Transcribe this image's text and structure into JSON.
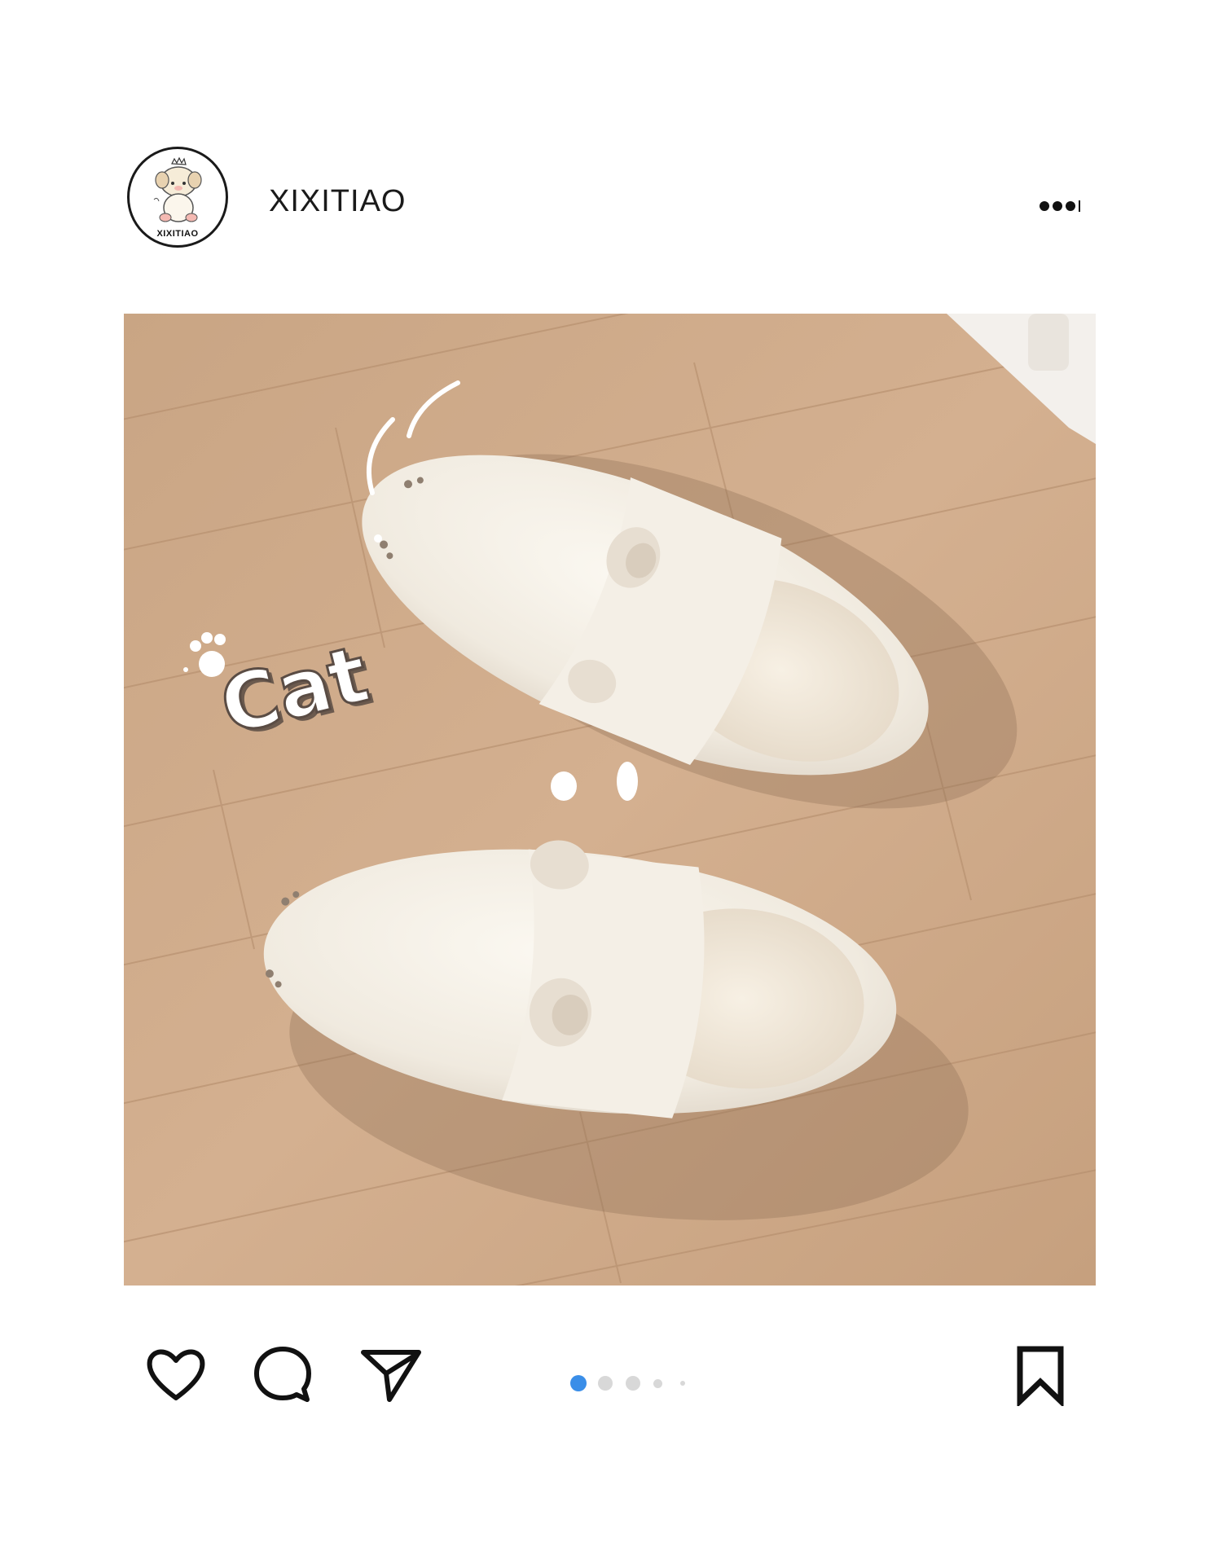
{
  "post": {
    "username": "XIXITIAO",
    "avatar_text": "XIXITIAO",
    "photo_label": "Cat",
    "icons": {
      "avatar": "bear-mascot-icon",
      "more": "more-options-icon",
      "like": "heart-icon",
      "comment": "comment-bubble-icon",
      "share": "send-icon",
      "save": "bookmark-icon"
    },
    "carousel": {
      "total": 5,
      "active": 1,
      "active_color": "#3a8ee8",
      "inactive_color": "#d8d8d8"
    }
  }
}
